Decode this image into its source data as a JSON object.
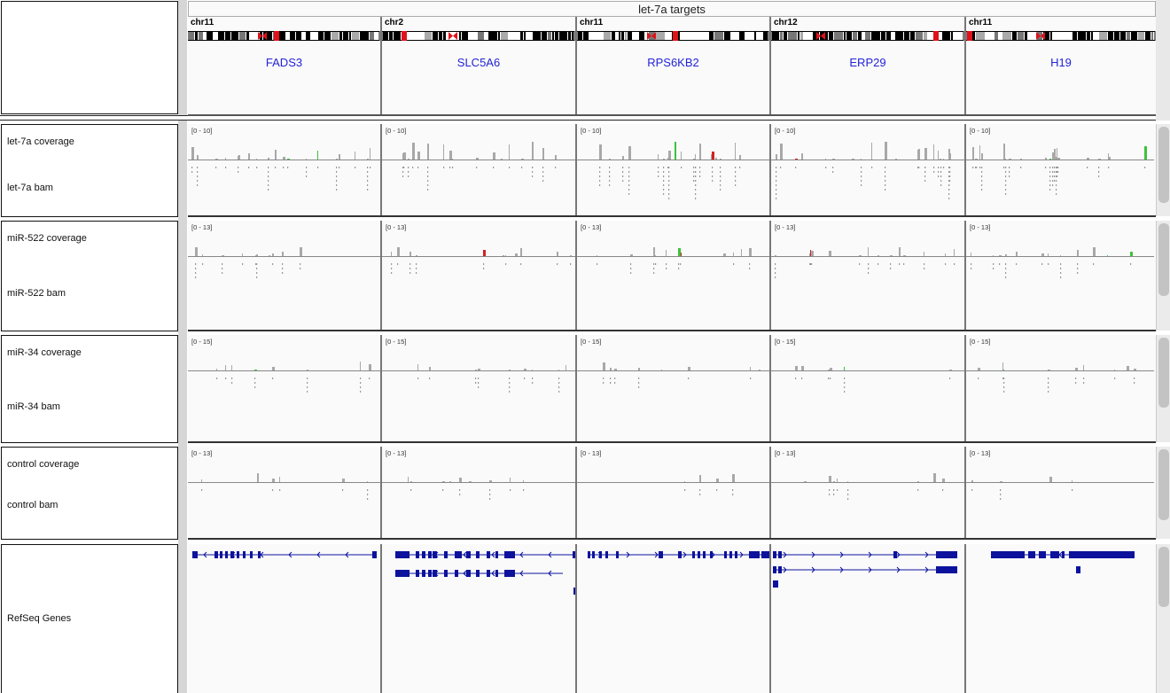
{
  "header": {
    "title": "let-7a targets"
  },
  "loci": [
    {
      "chr": "chr11",
      "gene": "FADS3"
    },
    {
      "chr": "chr2",
      "gene": "SLC5A6"
    },
    {
      "chr": "chr11",
      "gene": "RPS6KB2"
    },
    {
      "chr": "chr12",
      "gene": "ERP29"
    },
    {
      "chr": "chr11",
      "gene": "H19"
    }
  ],
  "tracks": [
    {
      "coverage_label": "let-7a coverage",
      "bam_label": "let-7a bam",
      "range": "[0 - 10]"
    },
    {
      "coverage_label": "miR-522 coverage",
      "bam_label": "miR-522 bam",
      "range": "[0 - 13]"
    },
    {
      "coverage_label": "miR-34 coverage",
      "bam_label": "miR-34 bam",
      "range": "[0 - 15]"
    },
    {
      "coverage_label": "control coverage",
      "bam_label": "control bam",
      "range": "[0 - 13]"
    }
  ],
  "refseq": {
    "label": "RefSeq Genes"
  },
  "colors": {
    "gene_name": "#2323d8",
    "gene_model": "#0c129c",
    "coverage_bar": "#a8a8a8",
    "cytoband_centromere": "#e0121a",
    "mismatch_green": "#3cc33c",
    "mismatch_red": "#d42020"
  }
}
